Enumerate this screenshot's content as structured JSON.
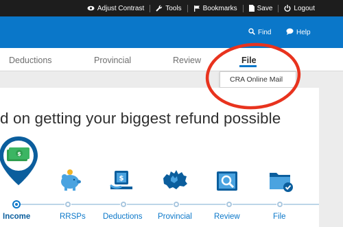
{
  "topbar": {
    "adjust_contrast": "Adjust Contrast",
    "tools": "Tools",
    "bookmarks": "Bookmarks",
    "save": "Save",
    "logout": "Logout"
  },
  "header": {
    "find": "Find",
    "help": "Help"
  },
  "tabs": [
    {
      "label": "Deductions"
    },
    {
      "label": "Provincial"
    },
    {
      "label": "Review"
    },
    {
      "label": "File",
      "active": true
    }
  ],
  "dropdown": {
    "item": "CRA Online Mail"
  },
  "main": {
    "headline": "d on getting your biggest refund possible"
  },
  "steps": [
    {
      "label": "Income",
      "icon": "money-pin-icon",
      "active": true
    },
    {
      "label": "RRSPs",
      "icon": "piggy-bank-icon"
    },
    {
      "label": "Deductions",
      "icon": "receipt-icon"
    },
    {
      "label": "Provincial",
      "icon": "canada-map-icon"
    },
    {
      "label": "Review",
      "icon": "magnifier-folder-icon"
    },
    {
      "label": "File",
      "icon": "folder-check-icon"
    }
  ],
  "colors": {
    "brand_blue": "#0a77c9",
    "annotation_red": "#e8331e",
    "topbar_bg": "#1d1d1d",
    "income_green": "#2f9e4f"
  }
}
